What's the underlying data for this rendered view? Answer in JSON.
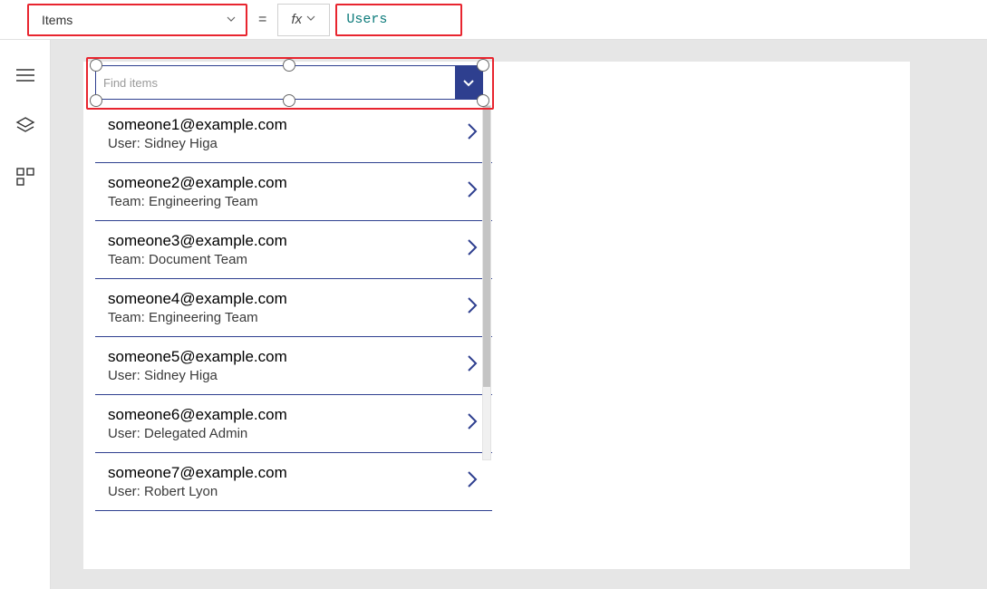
{
  "formula_bar": {
    "property_name": "Items",
    "equals": "=",
    "fx_label": "fx",
    "formula_value": "Users"
  },
  "combo": {
    "placeholder": "Find items"
  },
  "gallery": {
    "items": [
      {
        "title": "someone1@example.com",
        "sub": "User: Sidney Higa"
      },
      {
        "title": "someone2@example.com",
        "sub": "Team: Engineering Team"
      },
      {
        "title": "someone3@example.com",
        "sub": "Team: Document Team"
      },
      {
        "title": "someone4@example.com",
        "sub": "Team: Engineering Team"
      },
      {
        "title": "someone5@example.com",
        "sub": "User: Sidney Higa"
      },
      {
        "title": "someone6@example.com",
        "sub": "User: Delegated Admin"
      },
      {
        "title": "someone7@example.com",
        "sub": "User: Robert Lyon"
      }
    ]
  },
  "icons": {
    "hamburger": "hamburger-icon",
    "layers": "layers-icon",
    "components": "components-icon"
  }
}
